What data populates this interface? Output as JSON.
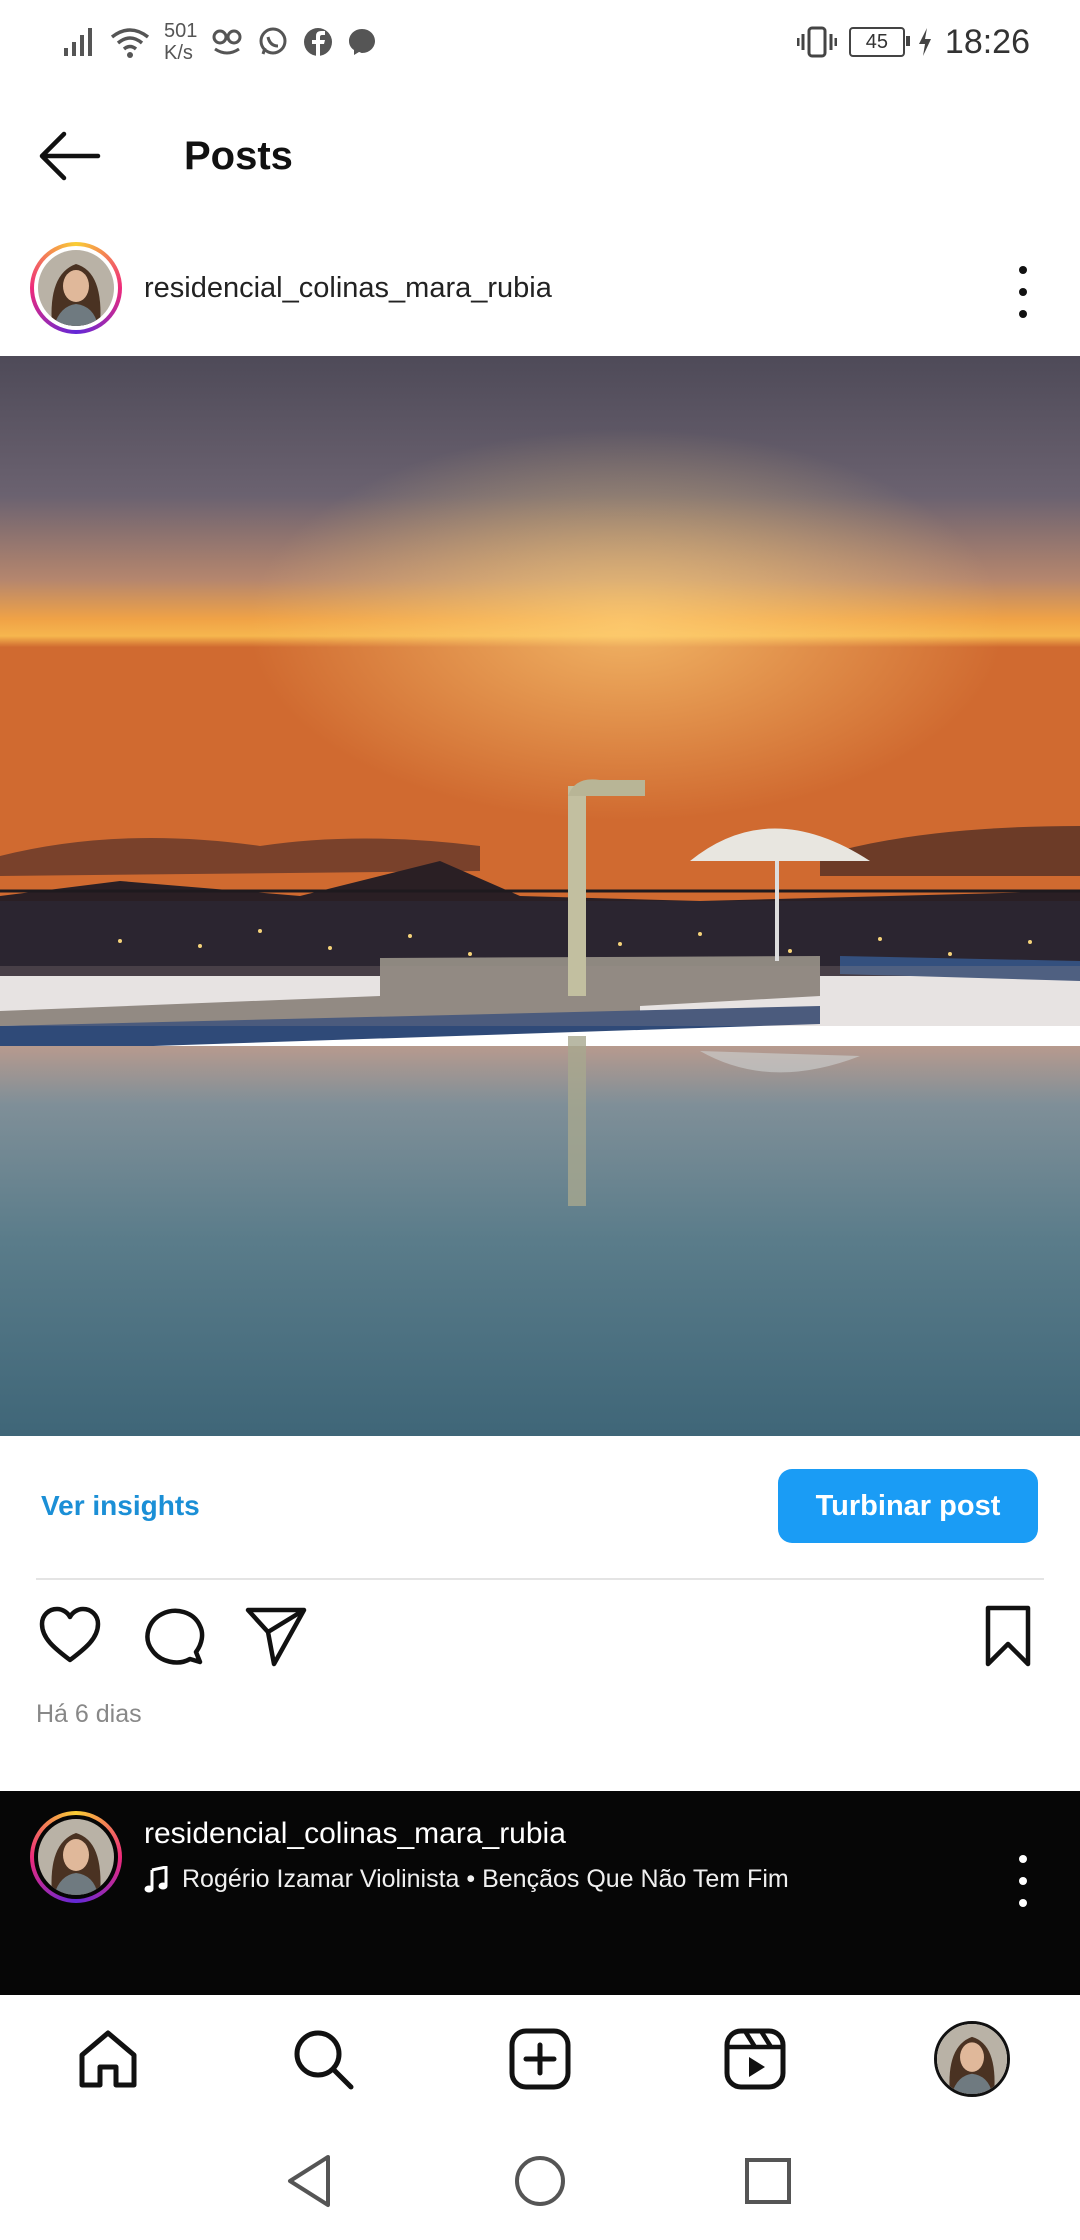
{
  "status_bar": {
    "speed_value": "501",
    "speed_unit": "K/s",
    "battery": "45",
    "time": "18:26",
    "icons": [
      "signal-icon",
      "wifi-icon",
      "app-notification-icon",
      "whatsapp-icon",
      "facebook-icon",
      "messenger-icon",
      "vibrate-icon",
      "battery-icon",
      "charging-icon"
    ]
  },
  "header": {
    "title": "Posts"
  },
  "post": {
    "username": "residencial_colinas_mara_rubia",
    "insights_label": "Ver insights",
    "boost_label": "Turbinar post",
    "time_ago": "Há 6 dias"
  },
  "next_post": {
    "username": "residencial_colinas_mara_rubia",
    "music": "Rogério Izamar Violinista • Bençãos Que Não Tem Fim"
  },
  "bottom_nav": [
    "home-icon",
    "search-icon",
    "create-icon",
    "reels-icon",
    "profile-avatar"
  ],
  "colors": {
    "accent": "#1a9cf5",
    "link": "#1b8fd6"
  }
}
